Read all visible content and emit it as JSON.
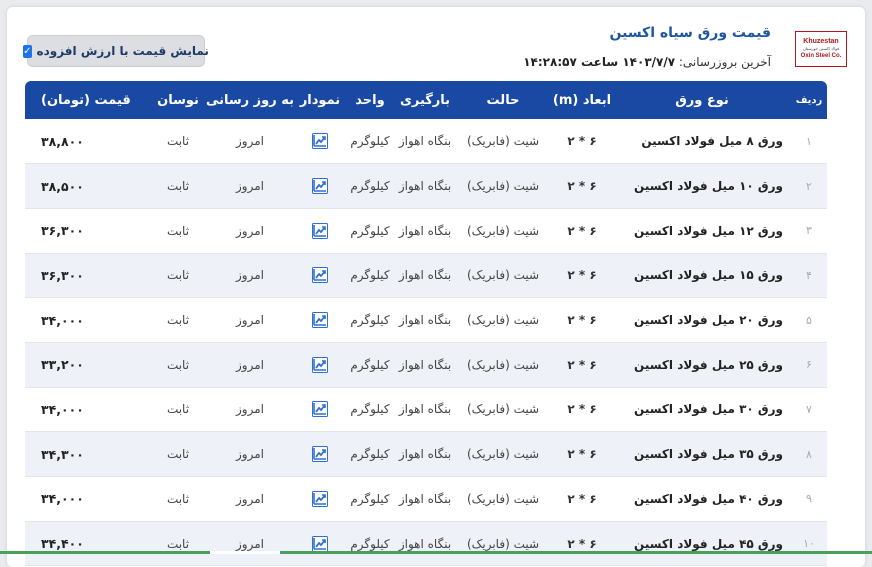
{
  "header": {
    "title": "قیمت ورق سیاه اکسین",
    "updated_label": "آخرین بروزرسانی:",
    "updated_value": "۱۴۰۳/۷/۷ ساعت ۱۴:۲۸:۵۷",
    "logo_line1": "Khuzestan",
    "logo_line2": "فولاد اکسین خوزستان",
    "logo_line3": "Oxin Steel Co."
  },
  "vat_toggle": {
    "label": "نمایش قیمت با ارزش افزوده",
    "checked": true
  },
  "columns": {
    "row": "ردیف",
    "type": "نوع ورق",
    "dimensions": "ابعاد (m)",
    "state": "حالت",
    "loading": "بارگیری",
    "unit": "واحد",
    "chart": "نمودار",
    "update": "به روز رسانی",
    "change": "نوسان",
    "price": "قیمت (تومان)"
  },
  "rows": [
    {
      "num": "۱",
      "type": "ورق ۸ میل فولاد اکسین",
      "dim": "۶ * ۲",
      "state": "شیت (فابریک)",
      "loading": "بنگاه اهواز",
      "unit": "کیلوگرم",
      "update": "امروز",
      "change": "ثابت",
      "price": "۳۸,۸۰۰"
    },
    {
      "num": "۲",
      "type": "ورق ۱۰ میل فولاد اکسین",
      "dim": "۶ * ۲",
      "state": "شیت (فابریک)",
      "loading": "بنگاه اهواز",
      "unit": "کیلوگرم",
      "update": "امروز",
      "change": "ثابت",
      "price": "۳۸,۵۰۰"
    },
    {
      "num": "۳",
      "type": "ورق ۱۲ میل فولاد اکسین",
      "dim": "۶ * ۲",
      "state": "شیت (فابریک)",
      "loading": "بنگاه اهواز",
      "unit": "کیلوگرم",
      "update": "امروز",
      "change": "ثابت",
      "price": "۳۶,۳۰۰"
    },
    {
      "num": "۴",
      "type": "ورق ۱۵ میل فولاد اکسین",
      "dim": "۶ * ۲",
      "state": "شیت (فابریک)",
      "loading": "بنگاه اهواز",
      "unit": "کیلوگرم",
      "update": "امروز",
      "change": "ثابت",
      "price": "۳۶,۳۰۰"
    },
    {
      "num": "۵",
      "type": "ورق ۲۰ میل فولاد اکسین",
      "dim": "۶ * ۲",
      "state": "شیت (فابریک)",
      "loading": "بنگاه اهواز",
      "unit": "کیلوگرم",
      "update": "امروز",
      "change": "ثابت",
      "price": "۳۴,۰۰۰"
    },
    {
      "num": "۶",
      "type": "ورق ۲۵ میل فولاد اکسین",
      "dim": "۶ * ۲",
      "state": "شیت (فابریک)",
      "loading": "بنگاه اهواز",
      "unit": "کیلوگرم",
      "update": "امروز",
      "change": "ثابت",
      "price": "۳۳,۲۰۰"
    },
    {
      "num": "۷",
      "type": "ورق ۳۰ میل فولاد اکسین",
      "dim": "۶ * ۲",
      "state": "شیت (فابریک)",
      "loading": "بنگاه اهواز",
      "unit": "کیلوگرم",
      "update": "امروز",
      "change": "ثابت",
      "price": "۳۴,۰۰۰"
    },
    {
      "num": "۸",
      "type": "ورق ۳۵ میل فولاد اکسین",
      "dim": "۶ * ۲",
      "state": "شیت (فابریک)",
      "loading": "بنگاه اهواز",
      "unit": "کیلوگرم",
      "update": "امروز",
      "change": "ثابت",
      "price": "۳۴,۳۰۰"
    },
    {
      "num": "۹",
      "type": "ورق ۴۰ میل فولاد اکسین",
      "dim": "۶ * ۲",
      "state": "شیت (فابریک)",
      "loading": "بنگاه اهواز",
      "unit": "کیلوگرم",
      "update": "امروز",
      "change": "ثابت",
      "price": "۳۴,۰۰۰"
    },
    {
      "num": "۱۰",
      "type": "ورق ۴۵ میل فولاد اکسین",
      "dim": "۶ * ۲",
      "state": "شیت (فابریک)",
      "loading": "بنگاه اهواز",
      "unit": "کیلوگرم",
      "update": "امروز",
      "change": "ثابت",
      "price": "۳۴,۴۰۰"
    }
  ],
  "icons": {
    "chart": "trend-chart-icon",
    "check": "checkmark-icon"
  },
  "colors": {
    "header_bg": "#1a49a3",
    "title": "#1e56a0",
    "accent": "#1e73e8",
    "logo_red": "#b1171c"
  }
}
